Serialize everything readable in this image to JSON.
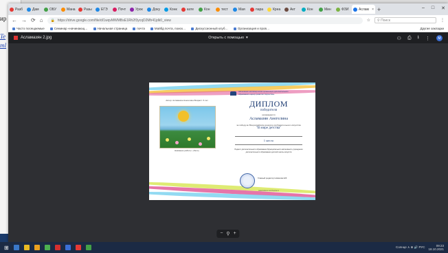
{
  "background_doc": {
    "fragment_1": "ир",
    "fragment_2": "Te",
    "fragment_3": "ml"
  },
  "browser": {
    "tabs": [
      {
        "label": "Разб",
        "color": "#e53935"
      },
      {
        "label": "Дам",
        "color": "#1e88e5"
      },
      {
        "label": "ОБУ",
        "color": "#43a047"
      },
      {
        "label": "Мана",
        "color": "#fb8c00"
      },
      {
        "label": "Разы",
        "color": "#e53935"
      },
      {
        "label": "ЕГЭ",
        "color": "#1e88e5"
      },
      {
        "label": "Почт",
        "color": "#d81b60"
      },
      {
        "label": "Урок",
        "color": "#8e24aa"
      },
      {
        "label": "Доку",
        "color": "#1e88e5"
      },
      {
        "label": "Конк",
        "color": "#039be5"
      },
      {
        "label": "кате",
        "color": "#e53935"
      },
      {
        "label": "Кон",
        "color": "#43a047"
      },
      {
        "label": "тест",
        "color": "#fb8c00"
      },
      {
        "label": "Мая",
        "color": "#1e88e5"
      },
      {
        "label": "пара",
        "color": "#e53935"
      },
      {
        "label": "Креа",
        "color": "#fdd835"
      },
      {
        "label": "Акт",
        "color": "#6d4c41"
      },
      {
        "label": "Кон",
        "color": "#00acc1"
      },
      {
        "label": "Мин",
        "color": "#43a047"
      },
      {
        "label": "ФЗИ",
        "color": "#7cb342"
      }
    ],
    "active_tab": {
      "label": "Аслам",
      "color": "#1a73e8"
    },
    "new_tab": "+",
    "window_controls": {
      "minimize": "–",
      "maximize": "□",
      "close": "✕"
    },
    "address": "https://drive.google.com/file/d/1wqvMWMBsE1Rh2f3ycqD2Mh41jdk0_view",
    "search_placeholder": "Поиск",
    "bookmarks": [
      "Часто посещаемые",
      "Семинар «начинающ…",
      "Начальная страница",
      "почта",
      "Майбд почта, поиск…",
      "Дискуссионный клуб…",
      "Организация и пров…"
    ],
    "other_bookmarks": "Другие закладки"
  },
  "viewer": {
    "file_name": "Асламазян 2.jpg",
    "open_with": "Открыть с помощью",
    "open_with_chevron": "▾",
    "avatar": "М",
    "zoom": {
      "out": "−",
      "icon": "⚲",
      "in": "+"
    }
  },
  "diploma": {
    "org": "Автономная некоммерческая организация дополнительного образования «Центр развития творчества»",
    "title": "ДИПЛОМ",
    "subtitle": "победителя",
    "awarded_label": "награждается",
    "winner_name": "Асламазян Анегелина",
    "contest_intro": "за победу во Всероссийском конкурсе изобразительного искусства",
    "contest_name": "\"В мире детства\"",
    "place": "1 место",
    "supervisor": "Педагог дополнительного образования Муниципального автономного учреждения дополнительного образования детской школы искусств",
    "director": "Главный редактор Новикова Е.В.",
    "footer": "www.konkurs-tvorchestva.ru",
    "author": "Автор: Асламазян Анегелина Возраст: 6 лет",
    "work_title": "Название работы: «Лето»"
  },
  "taskbar": {
    "start": "⊞",
    "icons": [
      "#3a78c9",
      "#e8b923",
      "#e8a020",
      "#4caf50",
      "#d32f2f",
      "#3b6fd6",
      "#e53935",
      "#43a047"
    ],
    "tray": "Солнце ∧ ⊕ 🔊 РУС",
    "time": "09:23",
    "date": "18.10.2021"
  }
}
